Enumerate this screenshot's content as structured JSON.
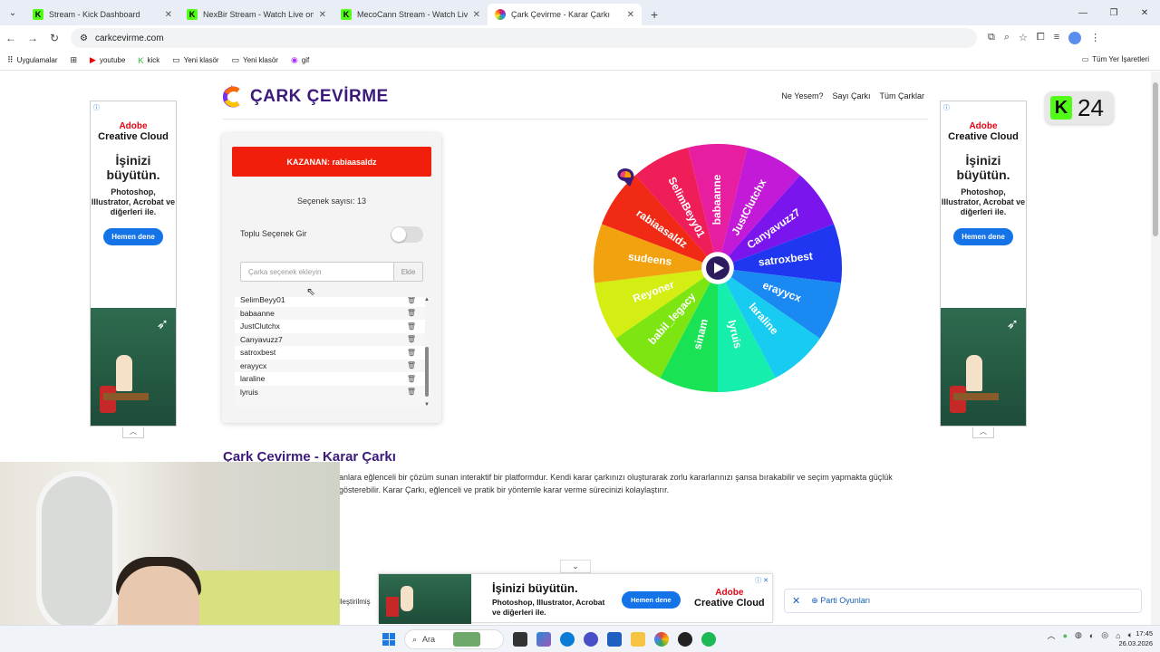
{
  "browser": {
    "tabs": [
      {
        "label": "Stream - Kick Dashboard",
        "icon": "kick-icon"
      },
      {
        "label": "NexBir Stream - Watch Live on",
        "icon": "kick-icon"
      },
      {
        "label": "MecoCann Stream - Watch Live",
        "icon": "kick-icon"
      },
      {
        "label": "Çark Çevirme - Karar Çarkı",
        "icon": "wheel-icon",
        "active": true
      }
    ],
    "url": "carkcevirme.com",
    "bookmarks": [
      "Uygulamalar",
      "youtube",
      "kick",
      "Yeni klasör",
      "Yeni klasör",
      "gif"
    ],
    "bookmarks_right": "Tüm Yer İşaretleri"
  },
  "site": {
    "logo_text": "ÇARK ÇEVİRME",
    "nav": [
      "Ne Yesem?",
      "Sayı Çarkı",
      "Tüm Çarklar"
    ]
  },
  "panel": {
    "winner": "KAZANAN: rabiaasaldz",
    "option_count": "Seçenek sayısı: 13",
    "bulk_label": "Toplu Seçenek Gir",
    "bulk_enabled": false,
    "input_placeholder": "Çarka seçenek ekleyin",
    "add_button": "Ekle",
    "options": [
      "SelimBeyy01",
      "babaanne",
      "JustClutchx",
      "Canyavuzz7",
      "satroxbest",
      "erayycx",
      "laraline",
      "lyruis"
    ]
  },
  "wheel": {
    "segments": [
      {
        "label": "babaanne",
        "color": "#e81ea0"
      },
      {
        "label": "JustClutchx",
        "color": "#c21ad6"
      },
      {
        "label": "Canyavuzz7",
        "color": "#7a15ee"
      },
      {
        "label": "satroxbest",
        "color": "#1f37f0"
      },
      {
        "label": "erayycx",
        "color": "#1a8af2"
      },
      {
        "label": "laraline",
        "color": "#17ccf0"
      },
      {
        "label": "lyruis",
        "color": "#16eeae"
      },
      {
        "label": "sinam",
        "color": "#19e255"
      },
      {
        "label": "babil_legacy",
        "color": "#7de612"
      },
      {
        "label": "Reyoner",
        "color": "#d4ee14"
      },
      {
        "label": "sudeens",
        "color": "#f2a20e"
      },
      {
        "label": "rabiaasaldz",
        "color": "#f02a14"
      },
      {
        "label": "SelimBeyy01",
        "color": "#f01e58"
      }
    ],
    "segment_labels_visible": [
      "babaanne",
      "JustClutchx",
      "Canyavuzz7",
      "satroxbest",
      "erayycx",
      "laraline",
      "lyruis",
      "sinam",
      "babil_legacy",
      "Reyoner",
      "sudeens",
      "rabiaasaldz",
      "SelimBeyy01"
    ]
  },
  "content": {
    "heading": "Çark Çevirme - Karar Çarkı",
    "description": "anlara eğlenceli bir çözüm sunan interaktif bir platformdur. Kendi karar çarkınızı oluşturarak zorlu kararlarınızı şansa bırakabilir ve seçim yapmakta güçlük gösterebilir. Karar Çarkı, eğlenceli ve pratik bir yöntemle karar verme sürecinizi kolaylaştırır.",
    "side_fragment": "lleştirilmiş"
  },
  "ads": {
    "brand": "Adobe",
    "product": "Creative Cloud",
    "headline": "İşinizi büyütün.",
    "body": "Photoshop, Illustrator, Acrobat ve diğerleri ile.",
    "cta": "Hemen dene"
  },
  "overlay": {
    "k24": "24",
    "party": "Parti Oyunları"
  },
  "taskbar": {
    "search": "Ara",
    "time": "17:45",
    "date": "26.03.2026"
  }
}
